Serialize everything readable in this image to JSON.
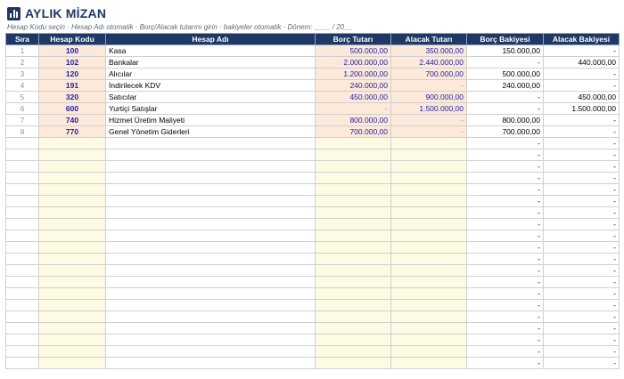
{
  "title": "AYLIK MİZAN",
  "subtitle": "Hesap Kodu seçin · Hesap Adı otomatik · Borç/Alacak tutarını girin · bakiyeler otomatik · Dönem: ____ / 20__",
  "icon": "bar-chart-icon",
  "colors": {
    "header": "#1f3864",
    "input_fill": "#fde9d9",
    "input_text": "#1f1fa8",
    "empty_input_fill": "#fdfbe3"
  },
  "columns": [
    "Sıra",
    "Hesap Kodu",
    "Hesap Adı",
    "Borç Tutarı",
    "Alacak Tutarı",
    "Borç Bakiyesi",
    "Alacak Bakiyesi"
  ],
  "rows": [
    {
      "sira": "1",
      "kod": "100",
      "ad": "Kasa",
      "borc": "500.000,00",
      "alacak": "350.000,00",
      "borc_bak": "150.000,00",
      "alacak_bak": "-"
    },
    {
      "sira": "2",
      "kod": "102",
      "ad": "Bankalar",
      "borc": "2.000.000,00",
      "alacak": "2.440.000,00",
      "borc_bak": "-",
      "alacak_bak": "440.000,00"
    },
    {
      "sira": "3",
      "kod": "120",
      "ad": "Alıcılar",
      "borc": "1.200.000,00",
      "alacak": "700.000,00",
      "borc_bak": "500.000,00",
      "alacak_bak": "-"
    },
    {
      "sira": "4",
      "kod": "191",
      "ad": "İndirilecek KDV",
      "borc": "240.000,00",
      "alacak": "-",
      "borc_bak": "240.000,00",
      "alacak_bak": "-"
    },
    {
      "sira": "5",
      "kod": "320",
      "ad": "Satıcılar",
      "borc": "450.000,00",
      "alacak": "900.000,00",
      "borc_bak": "-",
      "alacak_bak": "450.000,00"
    },
    {
      "sira": "6",
      "kod": "600",
      "ad": "Yurtiçi Satışlar",
      "borc": "-",
      "alacak": "1.500.000,00",
      "borc_bak": "-",
      "alacak_bak": "1.500.000,00"
    },
    {
      "sira": "7",
      "kod": "740",
      "ad": "Hizmet Üretim Maliyeti",
      "borc": "800.000,00",
      "alacak": "-",
      "borc_bak": "800.000,00",
      "alacak_bak": "-"
    },
    {
      "sira": "8",
      "kod": "770",
      "ad": "Genel Yönetim Giderleri",
      "borc": "700.000,00",
      "alacak": "-",
      "borc_bak": "700.000,00",
      "alacak_bak": "-"
    }
  ],
  "empty_row_value": "-"
}
